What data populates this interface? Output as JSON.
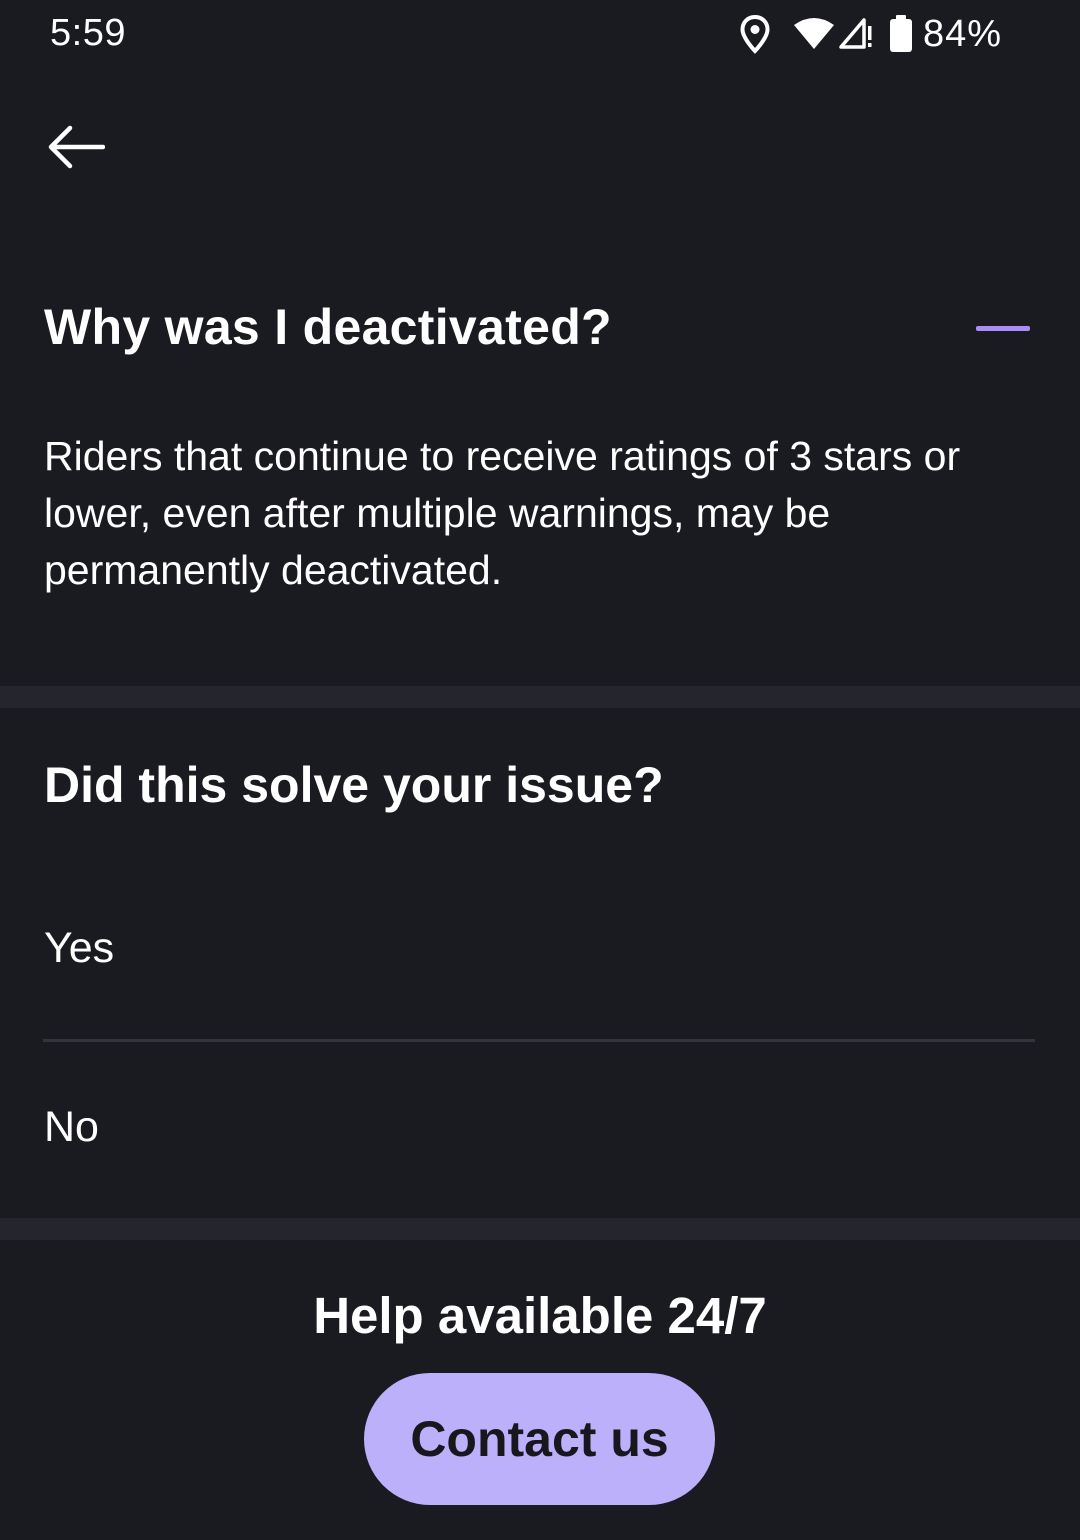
{
  "status_bar": {
    "time": "5:59",
    "battery": "84%",
    "icons": [
      "location-icon",
      "wifi-icon",
      "signal-icon",
      "battery-icon"
    ]
  },
  "header": {
    "back_icon": "arrow-left-icon"
  },
  "faq": {
    "title": "Why was I deactivated?",
    "toggle_icon": "collapse-minus-icon",
    "answer": "Riders that continue to receive ratings of 3 stars or lower, even after multiple warnings, may be permanently deactivated."
  },
  "feedback": {
    "question": "Did this solve your issue?",
    "options": [
      "Yes",
      "No"
    ]
  },
  "help": {
    "title": "Help available 24/7",
    "contact_label": "Contact us"
  },
  "colors": {
    "background": "#1a1a21",
    "divider": "#25252d",
    "accent": "#a98ef7",
    "button": "#bcb0fb"
  }
}
